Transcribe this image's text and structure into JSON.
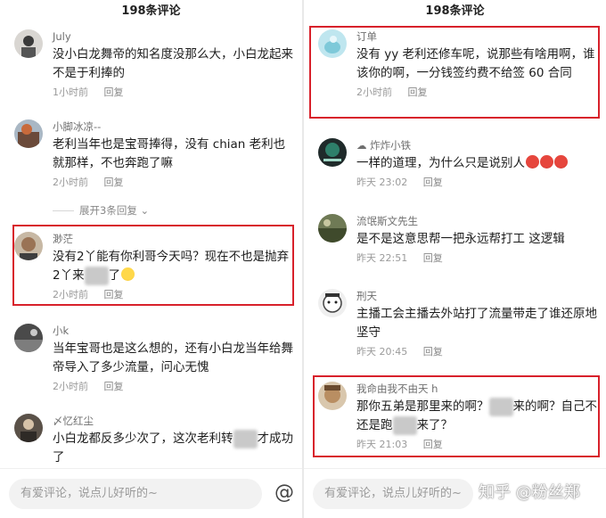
{
  "left": {
    "title": "198条评论",
    "comments": [
      {
        "user": "July",
        "text": "没小白龙舞帝的知名度没那么大，小白龙起来不是于利捧的",
        "time": "1小时前",
        "reply": "回复"
      },
      {
        "user": "小脚冰凉--",
        "text": "老利当年也是宝哥捧得，没有 chian 老利也就那样，不也奔跑了嘛",
        "time": "2小时前",
        "reply": "回复"
      },
      {
        "user": "渺茫",
        "text_a": "没有2丫能有你利哥今天吗？现在不也是抛弃2丫来",
        "blur": "某某",
        "text_b": "了",
        "time": "2小时前",
        "reply": "回复"
      },
      {
        "user": "小k",
        "text": "当年宝哥也是这么想的，还有小白龙当年给舞帝导入了多少流量，问心无愧",
        "time": "2小时前",
        "reply": "回复"
      },
      {
        "user": "〆忆红尘",
        "text_a": "小白龙都反多少次了，这次老利转",
        "blur": "某某",
        "text_b": "才成功了"
      }
    ],
    "expand_label": "展开3条回复",
    "input_placeholder": "有爱评论，说点儿好听的~",
    "at_symbol": "@"
  },
  "right": {
    "title": "198条评论",
    "comments": [
      {
        "user": "订单",
        "text": "没有 yy 老利还修车呢，说那些有啥用啊，谁该你的啊，一分钱签约费不给签 60 合同",
        "time": "2小时前",
        "reply": "回复"
      },
      {
        "user": "炸炸小铁",
        "text": "一样的道理，为什么只是说别人",
        "time": "昨天 23:02",
        "reply": "回复"
      },
      {
        "user": "流氓斯文先生",
        "text": "是不是这意思帮一把永远帮打工 这逻辑",
        "time": "昨天 22:51",
        "reply": "回复"
      },
      {
        "user": "刑天",
        "text": "主播工会主播去外站打了流量带走了谁还原地坚守",
        "time": "昨天 20:45",
        "reply": "回复"
      },
      {
        "user": "我命由我不由天 h",
        "text_a": "那你五弟是那里来的啊？",
        "blur1": "某某",
        "text_b": "来的啊？自己不还是跑",
        "blur2": "某某",
        "text_c": "来了？",
        "time": "昨天 21:03",
        "reply": "回复"
      }
    ],
    "input_placeholder": "有爱评论，说点儿好听的~",
    "watermark": "知乎 @粉丝郑"
  },
  "colors": {
    "highlight": "#d8212b",
    "meta": "#9a9a9a"
  }
}
